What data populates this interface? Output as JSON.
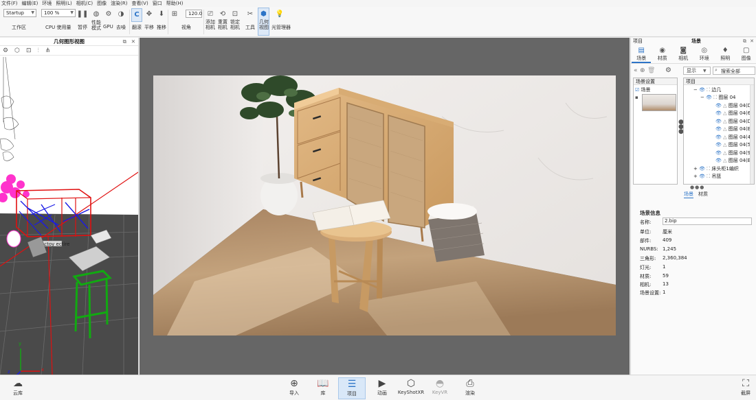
{
  "menu": [
    "文件(F)",
    "编辑(E)",
    "环境",
    "照明(L)",
    "相机(C)",
    "图像",
    "渲染(R)",
    "查看(V)",
    "窗口",
    "帮助(H)"
  ],
  "toolbar": {
    "workspace_value": "Startup",
    "workspace_label": "工作区",
    "cpu_value": "100 %",
    "cpu_label": "CPU 使用量",
    "pause_label": "暂停",
    "perf_label": "性能\n模式",
    "gpu_label": "GPU",
    "denoise_label": "去噪",
    "tumble_label": "翻滚",
    "pan_label": "平移",
    "dolly_label": "推移",
    "fov_value": "120.0",
    "fov_label": "视角",
    "add_camera_label": "添加\n相机",
    "reset_camera_label": "重置\n相机",
    "lock_camera_label": "锁定\n相机",
    "tools_label": "工具",
    "geometry_view_label": "几何\n视图",
    "light_manager_label": "光管理器"
  },
  "left_panel": {
    "title": "几何图形视图",
    "axis_x": "x",
    "axis_y": "y",
    "axis_z": "z"
  },
  "right_panel": {
    "project_label": "项目",
    "scene_title": "场景",
    "tabs": [
      "场景",
      "材质",
      "相机",
      "环境",
      "照明",
      "图像"
    ],
    "show_label": "显示",
    "search_placeholder": "搜索全部",
    "scene_settings_header": "场景设置",
    "project_header": "项目",
    "scene_settings_item": "场景",
    "tree": [
      "边几",
      "图层 04",
      "图层 04(D",
      "图层 04(6",
      "图层 04(D",
      "图层 04(B",
      "图层 04(4",
      "图层 04(5",
      "图层 04(9",
      "图层 04(B",
      "床头柜1编织",
      "吊篮"
    ],
    "subtabs": [
      "场景",
      "材质"
    ],
    "info_title": "场景信息",
    "info": {
      "name_label": "名称:",
      "name_value": "2.bip",
      "unit_label": "单位:",
      "unit_value": "厘米",
      "parts_label": "部件:",
      "parts_value": "409",
      "nurbs_label": "NURBS:",
      "nurbs_value": "1,245",
      "tris_label": "三角形:",
      "tris_value": "2,360,384",
      "lights_label": "灯光:",
      "lights_value": "1",
      "materials_label": "材质:",
      "materials_value": "59",
      "cameras_label": "相机:",
      "cameras_value": "13",
      "scenesets_label": "场景设置:",
      "scenesets_value": "1"
    }
  },
  "bottom": {
    "cloud_label": "云库",
    "import_label": "导入",
    "library_label": "库",
    "project_label": "项目",
    "animation_label": "动画",
    "keyshotxr_label": "KeyShotXR",
    "keyvr_label": "KeyVR",
    "render_label": "渲染",
    "screenshot_label": "截屏"
  },
  "colors": {
    "accent": "#2c74c7",
    "viewport_bg": "#666666"
  }
}
